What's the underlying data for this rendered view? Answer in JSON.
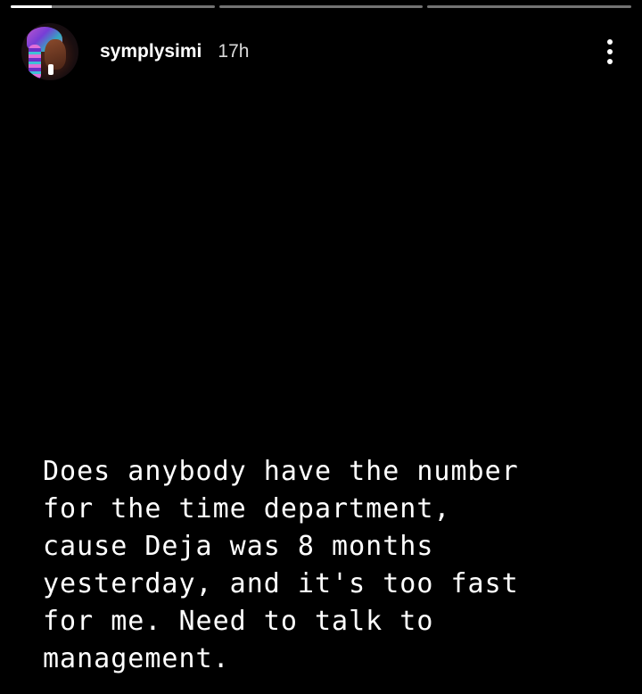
{
  "story": {
    "segments": [
      {
        "progress": 0.2
      },
      {
        "progress": 0
      },
      {
        "progress": 0
      }
    ],
    "username": "symplysimi",
    "timestamp": "17h",
    "caption_lines": [
      "Does anybody have the number",
      "for the time department,",
      "cause Deja was 8 months",
      "yesterday, and it's too fast",
      "for me. Need to talk to",
      "management."
    ]
  },
  "icons": {
    "avatar": "profile-avatar",
    "menu": "more-vertical-icon"
  }
}
